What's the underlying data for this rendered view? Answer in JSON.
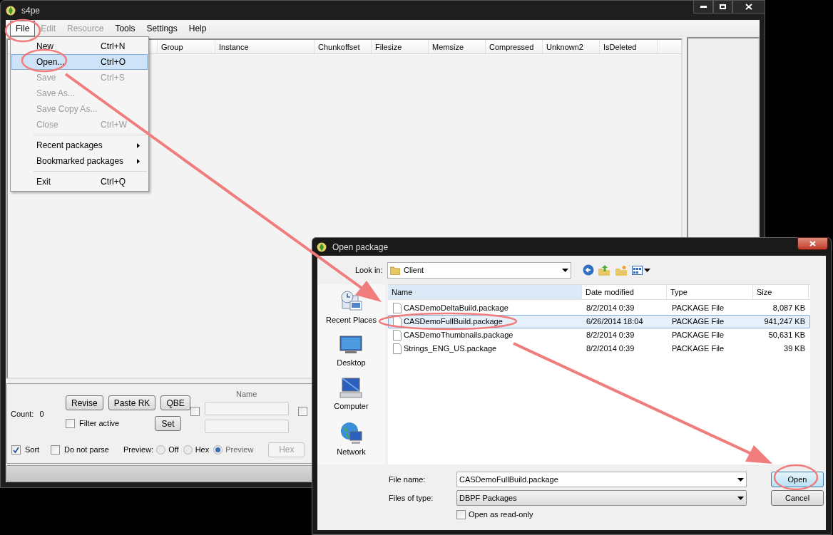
{
  "main_window": {
    "title": "s4pe",
    "menu": [
      {
        "label": "File",
        "disabled": false,
        "open": true
      },
      {
        "label": "Edit",
        "disabled": true,
        "open": false
      },
      {
        "label": "Resource",
        "disabled": true,
        "open": false
      },
      {
        "label": "Tools",
        "disabled": false,
        "open": false
      },
      {
        "label": "Settings",
        "disabled": false,
        "open": false
      },
      {
        "label": "Help",
        "disabled": false,
        "open": false
      }
    ],
    "file_menu": [
      {
        "kind": "item",
        "label": "New",
        "shortcut": "Ctrl+N",
        "disabled": false,
        "selected": false
      },
      {
        "kind": "item",
        "label": "Open...",
        "shortcut": "Ctrl+O",
        "disabled": false,
        "selected": true
      },
      {
        "kind": "item",
        "label": "Save",
        "shortcut": "Ctrl+S",
        "disabled": true,
        "selected": false
      },
      {
        "kind": "item",
        "label": "Save As...",
        "disabled": true,
        "selected": false
      },
      {
        "kind": "item",
        "label": "Save Copy As...",
        "disabled": true,
        "selected": false
      },
      {
        "kind": "item",
        "label": "Close",
        "shortcut": "Ctrl+W",
        "disabled": true,
        "selected": false
      },
      {
        "kind": "separator"
      },
      {
        "kind": "submenu",
        "label": "Recent packages",
        "disabled": false,
        "selected": false
      },
      {
        "kind": "submenu",
        "label": "Bookmarked packages",
        "disabled": false,
        "selected": false
      },
      {
        "kind": "separator"
      },
      {
        "kind": "item",
        "label": "Exit",
        "shortcut": "Ctrl+Q",
        "disabled": false,
        "selected": false
      }
    ],
    "columns": [
      "Group",
      "Instance",
      "Chunkoffset",
      "Filesize",
      "Memsize",
      "Compressed",
      "Unknown2",
      "IsDeleted"
    ],
    "count_label": "Count:",
    "count_value": "0",
    "buttons": [
      {
        "label": "Revise",
        "disabled": false
      },
      {
        "label": "Paste RK",
        "disabled": false
      },
      {
        "label": "QBE",
        "disabled": false
      },
      {
        "label": "Set",
        "disabled": false
      }
    ],
    "filter_active": {
      "label": "Filter active",
      "checked": false
    },
    "name_filter": {
      "label": "Name",
      "checked": false
    },
    "tag_filter": {
      "checked": false
    },
    "sort": {
      "label": "Sort",
      "checked": true
    },
    "do_not_parse": {
      "label": "Do not parse",
      "checked": false
    },
    "preview_label": "Preview:",
    "preview_options": [
      {
        "label": "Off",
        "selected": false
      },
      {
        "label": "Hex",
        "selected": false
      },
      {
        "label": "Preview",
        "selected": true
      }
    ],
    "hex_button": {
      "label": "Hex",
      "disabled": true
    }
  },
  "dialog": {
    "title": "Open package",
    "look_in_label": "Look in:",
    "look_in": "Client",
    "places": [
      {
        "label": "Recent Places",
        "kind": "recent"
      },
      {
        "label": "Desktop",
        "kind": "desktop"
      },
      {
        "label": "Computer",
        "kind": "computer"
      },
      {
        "label": "Network",
        "kind": "network"
      }
    ],
    "columns": [
      "Name",
      "Date modified",
      "Type",
      "Size"
    ],
    "files": [
      {
        "name": "CASDemoDeltaBuild.package",
        "date": "8/2/2014 0:39",
        "type": "PACKAGE File",
        "size": "8,087 KB",
        "selected": false
      },
      {
        "name": "CASDemoFullBuild.package",
        "date": "6/26/2014 18:04",
        "type": "PACKAGE File",
        "size": "941,247 KB",
        "selected": true
      },
      {
        "name": "CASDemoThumbnails.package",
        "date": "8/2/2014 0:39",
        "type": "PACKAGE File",
        "size": "50,631 KB",
        "selected": false
      },
      {
        "name": "Strings_ENG_US.package",
        "date": "8/2/2014 0:39",
        "type": "PACKAGE File",
        "size": "39 KB",
        "selected": false
      }
    ],
    "file_name_label": "File name:",
    "file_name": "CASDemoFullBuild.package",
    "file_type_label": "Files of type:",
    "file_type": "DBPF Packages",
    "read_only": {
      "label": "Open as read-only",
      "checked": false
    },
    "open_button": "Open",
    "cancel_button": "Cancel"
  }
}
